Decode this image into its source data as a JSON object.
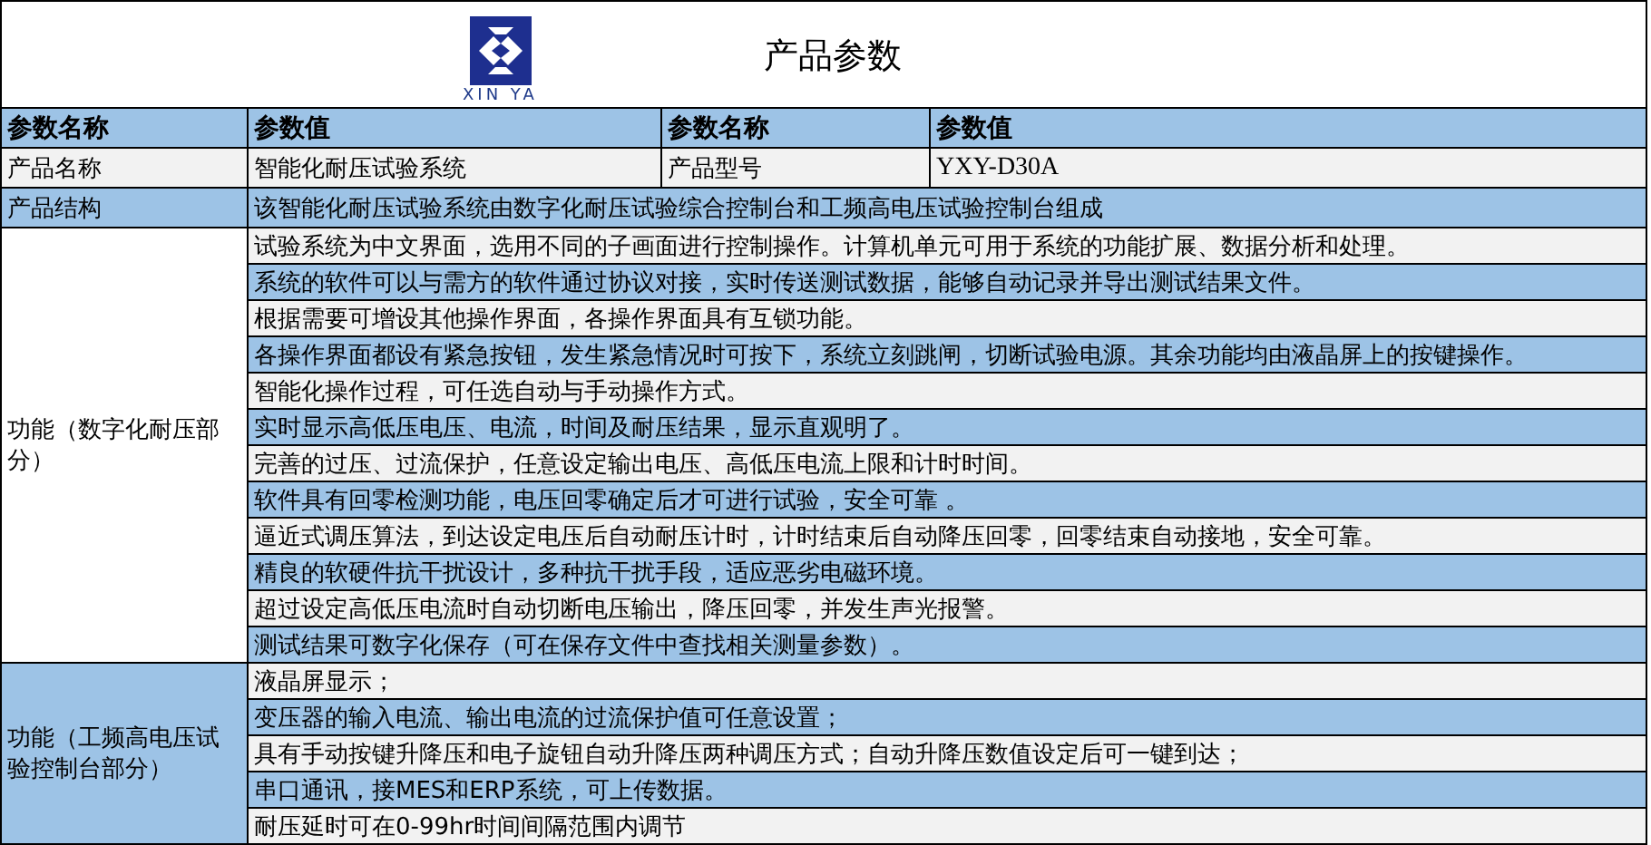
{
  "header": {
    "logo_text": "XIN YA",
    "title": "产品参数"
  },
  "columns": [
    "参数名称",
    "参数值",
    "参数名称",
    "参数值"
  ],
  "product_row": {
    "label": "产品名称",
    "value": "智能化耐压试验系统",
    "label_2": "产品型号",
    "value_2": "YXY-D30A",
    "shaded": false
  },
  "structure_row": {
    "label": "产品结构",
    "value": "该智能化耐压试验系统由数字化耐压试验综合控制台和工频高电压试验控制台组成",
    "shaded": true
  },
  "feature_groups": [
    {
      "label": "功能（数字化耐压部分）",
      "shaded": false,
      "items": [
        {
          "text": "试验系统为中文界面，选用不同的子画面进行控制操作。计算机单元可用于系统的功能扩展、数据分析和处理。",
          "shaded": false
        },
        {
          "text": "系统的软件可以与需方的软件通过协议对接，实时传送测试数据，能够自动记录并导出测试结果文件。",
          "shaded": true
        },
        {
          "text": "根据需要可增设其他操作界面，各操作界面具有互锁功能。",
          "shaded": false
        },
        {
          "text": "各操作界面都设有紧急按钮，发生紧急情况时可按下，系统立刻跳闸，切断试验电源。其余功能均由液晶屏上的按键操作。",
          "shaded": true
        },
        {
          "text": "智能化操作过程，可任选自动与手动操作方式。",
          "shaded": false
        },
        {
          "text": "实时显示高低压电压、电流，时间及耐压结果，显示直观明了。",
          "shaded": true
        },
        {
          "text": "完善的过压、过流保护，任意设定输出电压、高低压电流上限和计时时间。",
          "shaded": false
        },
        {
          "text": "软件具有回零检测功能，电压回零确定后才可进行试验，安全可靠 。",
          "shaded": true
        },
        {
          "text": "逼近式调压算法，到达设定电压后自动耐压计时，计时结束后自动降压回零，回零结束自动接地，安全可靠。",
          "shaded": false
        },
        {
          "text": "精良的软硬件抗干扰设计，多种抗干扰手段，适应恶劣电磁环境。",
          "shaded": true
        },
        {
          "text": "超过设定高低压电流时自动切断电压输出，降压回零，并发生声光报警。",
          "shaded": false
        },
        {
          "text": "测试结果可数字化保存（可在保存文件中查找相关测量参数）。",
          "shaded": true
        }
      ]
    },
    {
      "label": "功能（工频高电压试验控制台部分）",
      "shaded": true,
      "items": [
        {
          "text": "液晶屏显示；",
          "shaded": false
        },
        {
          "text": "变压器的输入电流、输出电流的过流保护值可任意设置；",
          "shaded": true
        },
        {
          "text": "具有手动按键升降压和电子旋钮自动升降压两种调压方式；自动升降压数值设定后可一键到达；",
          "shaded": false
        },
        {
          "text": "串口通讯，接MES和ERP系统，可上传数据。",
          "shaded": true
        },
        {
          "text": "耐压延时可在0-99hr时间间隔范围内调节",
          "shaded": false
        }
      ]
    }
  ]
}
